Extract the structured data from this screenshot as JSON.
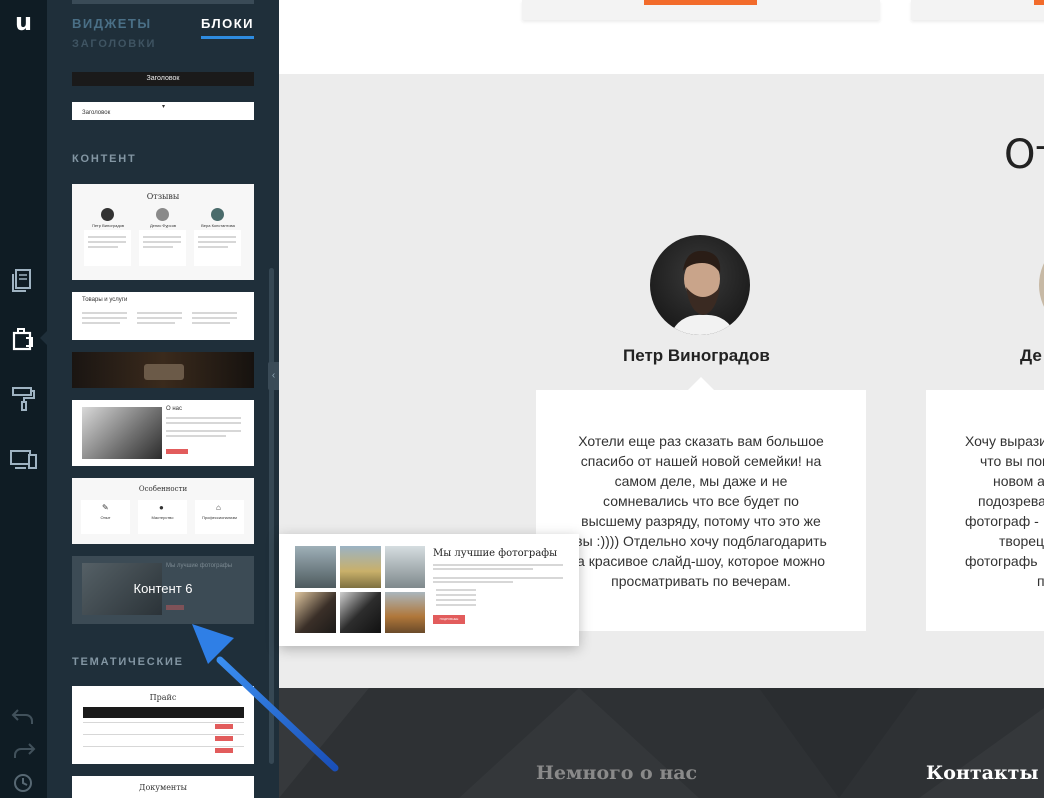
{
  "rail": {
    "logo": "u",
    "icons": [
      "pages-icon",
      "blocks-icon",
      "paint-roller-icon",
      "devices-icon",
      "undo-icon",
      "redo-icon",
      "history-icon"
    ]
  },
  "panel": {
    "tabs": {
      "widgets": "ВИДЖЕТЫ",
      "blocks": "БЛОКИ"
    },
    "sections": {
      "headings": "ЗАГОЛОВКИ",
      "content": "КОНТЕНТ",
      "thematic": "ТЕМАТИЧЕСКИЕ"
    },
    "heading_thumbs": [
      "Заголовок",
      "Заголовок"
    ],
    "thumbs": {
      "reviews": {
        "title": "Отзывы",
        "names": [
          "Петр Виноградов",
          "Денис Фурсов",
          "Вера Константова"
        ]
      },
      "products": {
        "title": "Товары и услуги"
      },
      "about": {
        "title": "О нас"
      },
      "features": {
        "title": "Особенности",
        "items": [
          "Опыт",
          "Мастерство",
          "Профессионализм"
        ]
      },
      "content6": {
        "title": "Мы лучшие фотографы",
        "hover_label": "Контент 6"
      },
      "price": {
        "title": "Прайс"
      },
      "docs": {
        "title": "Документы"
      }
    }
  },
  "drag_preview": {
    "title": "Мы лучшие фотографы",
    "button": "ПОДРОБНЕЕ"
  },
  "main": {
    "section_title": "От",
    "person1": {
      "name": "Петр Виноградов",
      "review_lines": [
        "Хотели еще раз сказать вам большое",
        "спасибо от нашей новой семейки! на",
        "самом деле, мы даже и не",
        "сомневались что все будет по",
        "высшему разряду, потому что это же",
        "вы :)))) Отдельно хочу подблагодарить",
        "а красивое слайд-шоу, которое можно",
        "просматривать по вечерам."
      ]
    },
    "person2": {
      "name": "Де",
      "review_lines": [
        "Хочу вырази",
        "что вы пом",
        "новом а",
        "подозрева",
        "фотограф -",
        "творец.",
        "фотографь",
        "п"
      ]
    },
    "footer": {
      "about": "Немного о нас",
      "contacts": "Контакты"
    }
  },
  "colors": {
    "accent_blue": "#2e8ce0",
    "orange": "#f26b2b",
    "red_button": "#e25c5c"
  }
}
